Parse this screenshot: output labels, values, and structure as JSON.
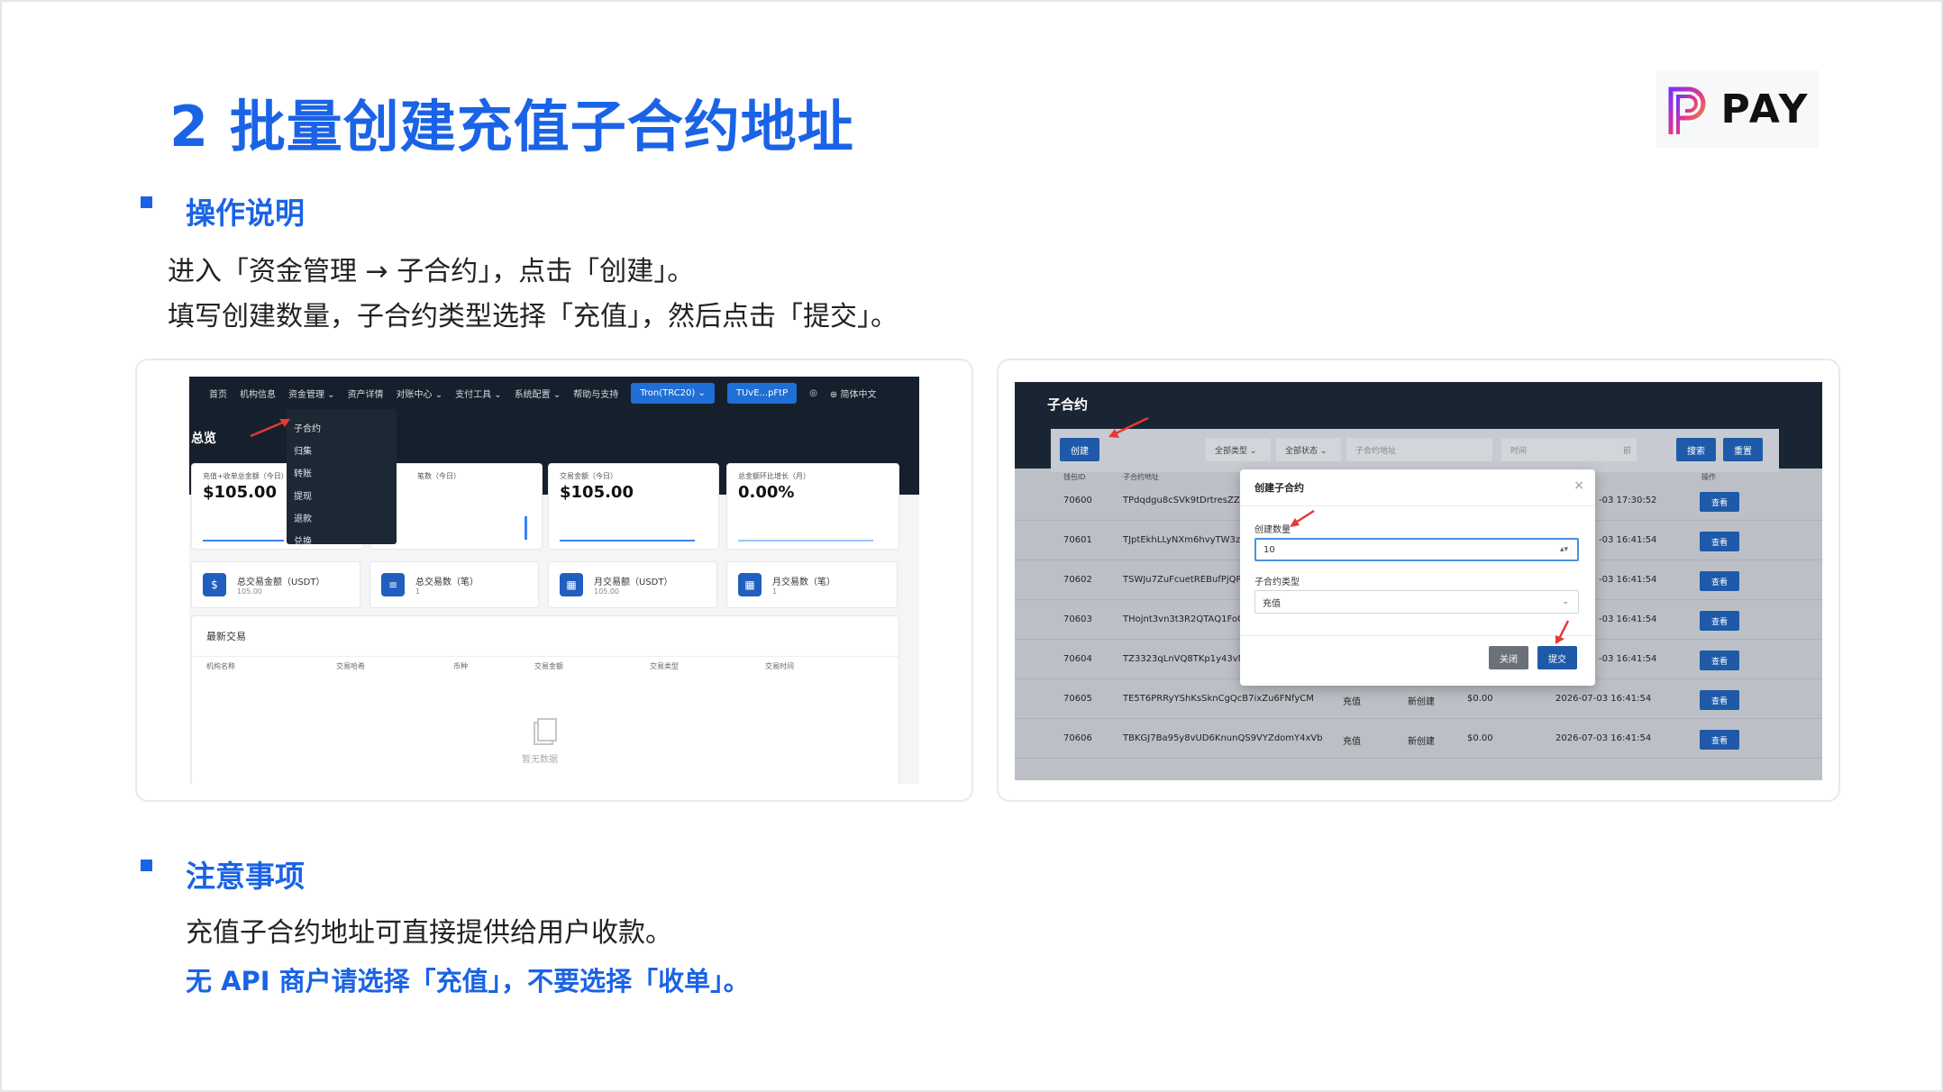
{
  "title": "2 批量创建充值子合约地址",
  "logo": {
    "text": "PAY"
  },
  "section1": {
    "heading": "操作说明",
    "lines": [
      "进入「资金管理 → 子合约」，点击「创建」。",
      "填写创建数量，子合约类型选择「充值」，然后点击「提交」。"
    ]
  },
  "left_shot": {
    "nav": [
      "首页",
      "机构信息",
      "资金管理 ⌄",
      "资产详情",
      "对账中心 ⌄",
      "支付工具 ⌄",
      "系统配置 ⌄",
      "帮助与支持"
    ],
    "network_button": "Tron(TRC20) ⌄",
    "wallet_button": "TUvE...pFtP",
    "language": "简体中文",
    "page_title": "总览",
    "dropdown": [
      "子合约",
      "归集",
      "转账",
      "提现",
      "退款",
      "兑换"
    ],
    "kpis": [
      {
        "label": "充值+收单总金额（今日）",
        "value": "$105.00"
      },
      {
        "label": "笔数（今日）",
        "value": ""
      },
      {
        "label": "交易金额（今日）",
        "value": "$105.00"
      },
      {
        "label": "总金额环比增长（月）",
        "value": "0.00%"
      }
    ],
    "stats": [
      {
        "label": "总交易金额（USDT）",
        "value": "105.00"
      },
      {
        "label": "总交易数（笔）",
        "value": "1"
      },
      {
        "label": "月交易额（USDT）",
        "value": "105.00"
      },
      {
        "label": "月交易数（笔）",
        "value": "1"
      }
    ],
    "recent": {
      "title": "最新交易",
      "columns": [
        "机构名称",
        "交易哈希",
        "币种",
        "交易金额",
        "交易类型",
        "交易时间"
      ],
      "empty": "暂无数据"
    }
  },
  "right_shot": {
    "title": "子合约",
    "create_button": "创建",
    "filters": {
      "type": "全部类型 ⌄",
      "status": "全部状态 ⌄",
      "address_placeholder": "子合约地址",
      "time_placeholder": "时间",
      "time_suffix": "前"
    },
    "search_button": "搜索",
    "reset_button": "重置",
    "columns": [
      "钱包ID",
      "子合约地址",
      "操作"
    ],
    "rows": [
      {
        "id": "70600",
        "address": "TPdqdgu8cSVk9tDrtresZZi",
        "type": "",
        "status": "",
        "amount": "",
        "time": "-03 17:30:52",
        "action": "查看"
      },
      {
        "id": "70601",
        "address": "TJptEkhLLyNXm6hvyTW3z",
        "type": "",
        "status": "",
        "amount": "",
        "time": "-03 16:41:54",
        "action": "查看"
      },
      {
        "id": "70602",
        "address": "TSWJu7ZuFcuetREBufPjQR",
        "type": "",
        "status": "",
        "amount": "",
        "time": "-03 16:41:54",
        "action": "查看"
      },
      {
        "id": "70603",
        "address": "THojnt3vn3t3R2QTAQ1FoG",
        "type": "",
        "status": "",
        "amount": "",
        "time": "-03 16:41:54",
        "action": "查看"
      },
      {
        "id": "70604",
        "address": "TZ3323qLnVQ8TKp1y43vN",
        "type": "",
        "status": "",
        "amount": "",
        "time": "-03 16:41:54",
        "action": "查看"
      },
      {
        "id": "70605",
        "address": "TE5T6PRRyYShKsSknCgQcB7ixZu6FNfyCM",
        "type": "充值",
        "status": "新创建",
        "amount": "$0.00",
        "time": "2026-07-03 16:41:54",
        "action": "查看"
      },
      {
        "id": "70606",
        "address": "TBKGJ7Ba95y8vUD6KnunQS9VYZdomY4xVb",
        "type": "充值",
        "status": "新创建",
        "amount": "$0.00",
        "time": "2026-07-03 16:41:54",
        "action": "查看"
      }
    ],
    "modal": {
      "title": "创建子合约",
      "close": "×",
      "quantity_label": "创建数量",
      "quantity_value": "10",
      "type_label": "子合约类型",
      "type_value": "充值",
      "cancel_button": "关闭",
      "submit_button": "提交"
    }
  },
  "section2": {
    "heading": "注意事项",
    "line1": "充值子合约地址可直接提供给用户收款。",
    "line2": "无 API 商户请选择「充值」，不要选择「收单」。"
  },
  "colors": {
    "accent": "#1a63e6",
    "nav_dark": "#16202c",
    "button_blue": "#1e5aa8",
    "arrow_red": "#e53935"
  }
}
